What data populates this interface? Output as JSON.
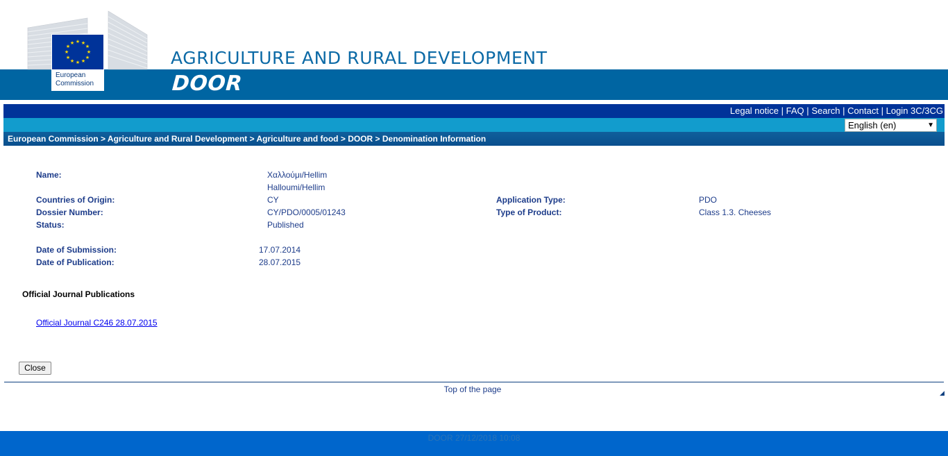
{
  "banner": {
    "logo_text_line1": "European",
    "logo_text_line2": "Commission",
    "department": "AGRICULTURE AND RURAL DEVELOPMENT",
    "app_name": "DOOR"
  },
  "topnav": {
    "items": [
      "Legal notice",
      "FAQ",
      "Search",
      "Contact",
      "Login 3C/3CG"
    ],
    "separator": "|"
  },
  "language": {
    "selected": "English (en)"
  },
  "breadcrumb": "European Commission > Agriculture and Rural Development > Agriculture and food > DOOR > Denomination Information",
  "details": {
    "name_label": "Name:",
    "name_values": [
      "Χαλλούμι/Hellim",
      "Halloumi/Hellim"
    ],
    "countries_label": "Countries of Origin:",
    "countries_value": "CY",
    "dossier_label": "Dossier Number:",
    "dossier_value": "CY/PDO/0005/01243",
    "status_label": "Status:",
    "status_value": "Published",
    "app_type_label": "Application Type:",
    "app_type_value": "PDO",
    "product_type_label": "Type of Product:",
    "product_type_value": "Class 1.3. Cheeses",
    "submission_label": "Date of Submission:",
    "submission_value": "17.07.2014",
    "publication_label": "Date of Publication:",
    "publication_value": "28.07.2015"
  },
  "publications": {
    "title": "Official Journal Publications",
    "link": "Official Journal C246 28.07.2015"
  },
  "close_label": "Close",
  "top_of_page": "Top of the page",
  "footer_text": "DOOR     27/12/2018 10:08",
  "colors": {
    "band": "#0065a2",
    "nav": "#003399",
    "langbar": "#129ccd",
    "footer": "#0066cc"
  }
}
